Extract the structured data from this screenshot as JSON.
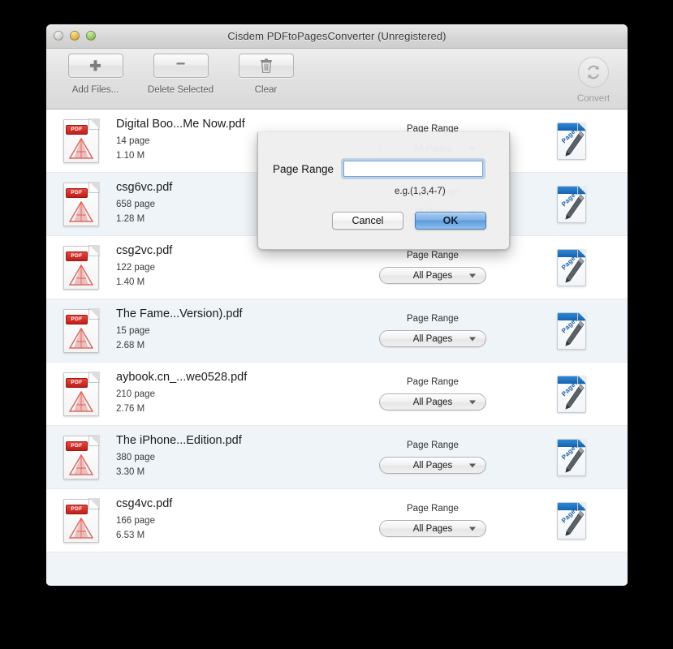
{
  "window": {
    "title": "Cisdem PDFtoPagesConverter (Unregistered)",
    "traffic_lights": [
      "close",
      "minimize",
      "maximize"
    ]
  },
  "toolbar": {
    "items": [
      {
        "label": "Add Files...",
        "icon": "plus-icon"
      },
      {
        "label": "Delete Selected",
        "icon": "minus-icon"
      },
      {
        "label": "Clear",
        "icon": "trash-icon"
      }
    ],
    "convert": {
      "label": "Convert",
      "icon": "convert-refresh-icon"
    }
  },
  "file_list": {
    "range_label": "Page Range",
    "range_value": "All Pages",
    "rows": [
      {
        "name": "Digital Boo...Me Now.pdf",
        "pages": "14 page",
        "size": "1.10 M",
        "selected": false
      },
      {
        "name": "csg6vc.pdf",
        "pages": "658 page",
        "size": "1.28 M",
        "selected": true
      },
      {
        "name": "csg2vc.pdf",
        "pages": "122 page",
        "size": "1.40 M",
        "selected": false
      },
      {
        "name": "The Fame...Version).pdf",
        "pages": "15 page",
        "size": "2.68 M",
        "selected": true
      },
      {
        "name": "aybook.cn_...we0528.pdf",
        "pages": "210 page",
        "size": "2.76 M",
        "selected": false
      },
      {
        "name": "The iPhone...Edition.pdf",
        "pages": "380 page",
        "size": "3.30 M",
        "selected": true
      },
      {
        "name": "csg4vc.pdf",
        "pages": "166 page",
        "size": "6.53 M",
        "selected": false
      }
    ],
    "pdf_badge_text": "PDF",
    "output_icon_text": "Pages"
  },
  "dialog": {
    "label": "Page Range",
    "input_value": "",
    "hint": "e.g.(1,3,4-7)",
    "cancel_label": "Cancel",
    "ok_label": "OK"
  },
  "colors": {
    "accent_blue": "#5d9adc",
    "selected_row": "#eef4f7",
    "pdf_red": "#bd1f18",
    "pages_blue": "#1565b0"
  }
}
